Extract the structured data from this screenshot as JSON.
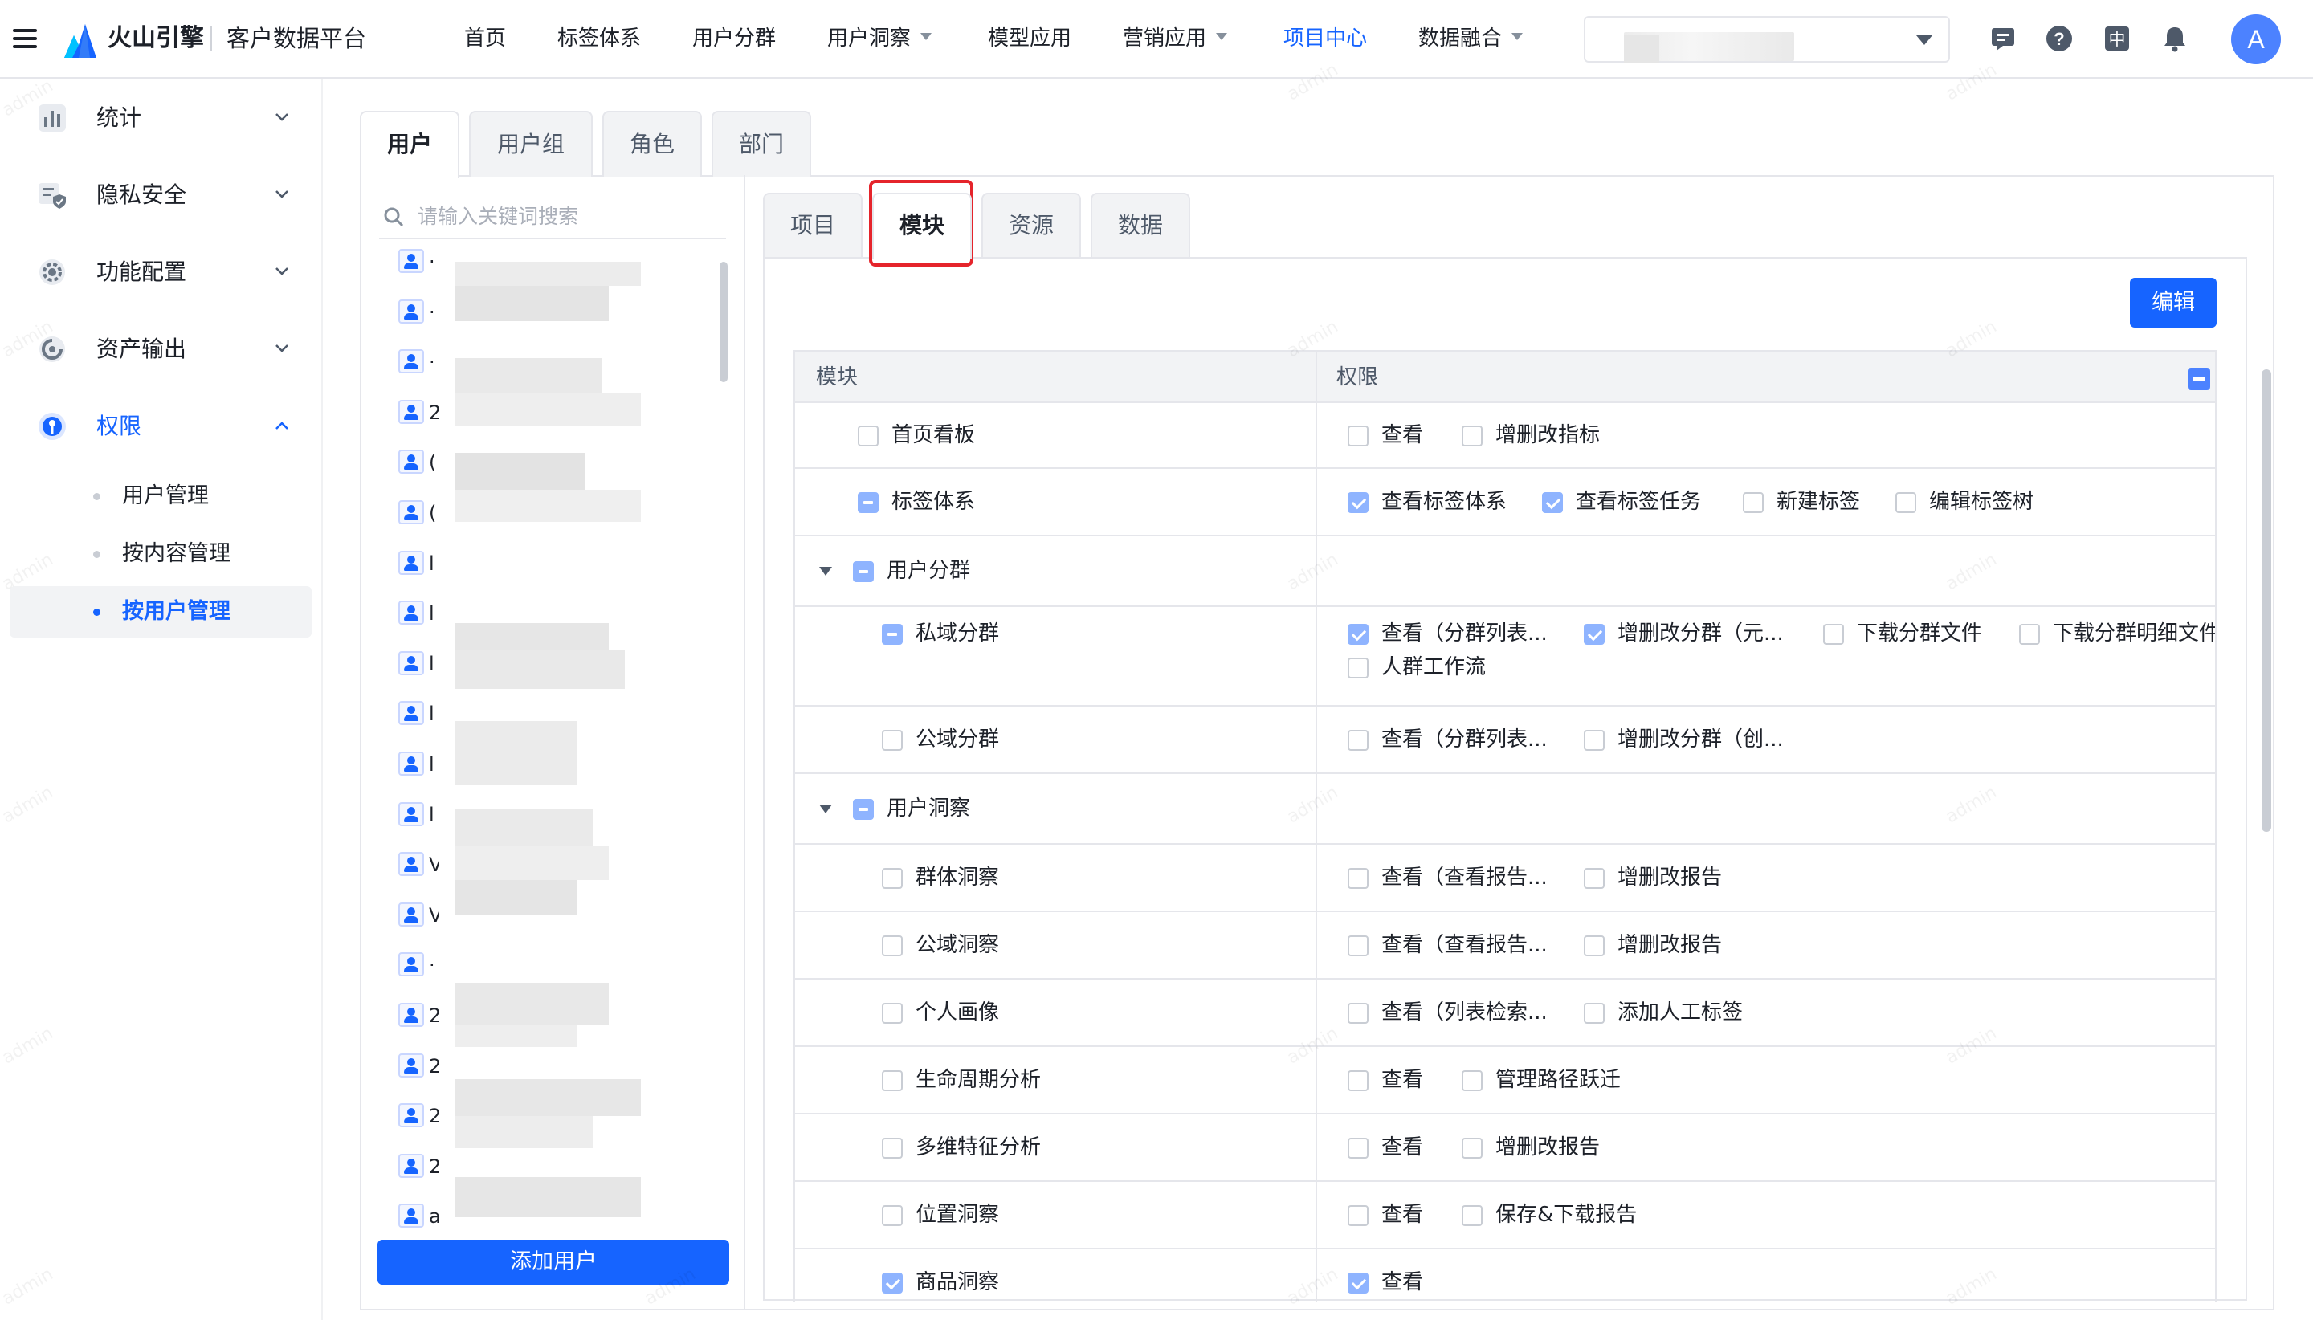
{
  "header": {
    "brand": "火山引擎",
    "product": "客户数据平台",
    "nav": [
      {
        "label": "首页",
        "dropdown": false,
        "active": false
      },
      {
        "label": "标签体系",
        "dropdown": false,
        "active": false
      },
      {
        "label": "用户分群",
        "dropdown": false,
        "active": false
      },
      {
        "label": "用户洞察",
        "dropdown": true,
        "active": false
      },
      {
        "label": "模型应用",
        "dropdown": false,
        "active": false
      },
      {
        "label": "营销应用",
        "dropdown": true,
        "active": false
      },
      {
        "label": "项目中心",
        "dropdown": false,
        "active": true
      },
      {
        "label": "数据融合",
        "dropdown": true,
        "active": false
      }
    ],
    "avatar_letter": "A",
    "icons": [
      "message-icon",
      "help-icon",
      "language-icon",
      "bell-icon"
    ],
    "language_glyph": "中",
    "help_glyph": "?"
  },
  "sidebar": {
    "items": [
      {
        "label": "统计",
        "icon": "chart-icon",
        "expanded": false
      },
      {
        "label": "隐私安全",
        "icon": "shield-icon",
        "expanded": false
      },
      {
        "label": "功能配置",
        "icon": "gear-icon",
        "expanded": false
      },
      {
        "label": "资产输出",
        "icon": "export-icon",
        "expanded": false
      },
      {
        "label": "权限",
        "icon": "key-icon",
        "expanded": true
      }
    ],
    "sub_items": [
      {
        "label": "用户管理",
        "active": false
      },
      {
        "label": "按内容管理",
        "active": false
      },
      {
        "label": "按用户管理",
        "active": true
      }
    ]
  },
  "outer_tabs": [
    "用户",
    "用户组",
    "角色",
    "部门"
  ],
  "user_panel": {
    "search_placeholder": "请输入关键词搜索",
    "users": [
      "·",
      "·",
      "·",
      "2",
      "(",
      "(",
      "l",
      "l",
      "l",
      "l",
      "l",
      "l",
      "V",
      "V",
      "·",
      "2",
      "2",
      "2",
      "2",
      "a"
    ],
    "add_user_label": "添加用户"
  },
  "inner_tabs": [
    "项目",
    "模块",
    "资源",
    "数据"
  ],
  "edit_label": "编辑",
  "table": {
    "col_module": "模块",
    "col_permission": "权限",
    "rows": [
      {
        "type": "module",
        "level": 0,
        "name": "首页看板",
        "state": "unchecked",
        "perms": [
          {
            "label": "查看",
            "checked": false
          },
          {
            "label": "增删改指标",
            "checked": false
          }
        ]
      },
      {
        "type": "module",
        "level": 0,
        "name": "标签体系",
        "state": "indet",
        "perms": [
          {
            "label": "查看标签体系",
            "checked": true
          },
          {
            "label": "查看标签任务",
            "checked": true
          },
          {
            "label": "新建标签",
            "checked": false
          },
          {
            "label": "编辑标签树",
            "checked": false
          }
        ]
      },
      {
        "type": "group",
        "level": 0,
        "name": "用户分群",
        "state": "indet",
        "perms": []
      },
      {
        "type": "module",
        "level": 1,
        "name": "私域分群",
        "state": "indet",
        "perms": [
          {
            "label": "查看（分群列表...",
            "checked": true
          },
          {
            "label": "增删改分群（元...",
            "checked": true
          },
          {
            "label": "下载分群文件",
            "checked": false
          },
          {
            "label": "下载分群明细文件",
            "checked": false
          },
          {
            "label": "人群工作流",
            "checked": false
          }
        ]
      },
      {
        "type": "module",
        "level": 1,
        "name": "公域分群",
        "state": "unchecked",
        "perms": [
          {
            "label": "查看（分群列表...",
            "checked": false
          },
          {
            "label": "增删改分群（创...",
            "checked": false
          }
        ]
      },
      {
        "type": "group",
        "level": 0,
        "name": "用户洞察",
        "state": "indet",
        "perms": []
      },
      {
        "type": "module",
        "level": 1,
        "name": "群体洞察",
        "state": "unchecked",
        "perms": [
          {
            "label": "查看（查看报告...",
            "checked": false
          },
          {
            "label": "增删改报告",
            "checked": false
          }
        ]
      },
      {
        "type": "module",
        "level": 1,
        "name": "公域洞察",
        "state": "unchecked",
        "perms": [
          {
            "label": "查看（查看报告...",
            "checked": false
          },
          {
            "label": "增删改报告",
            "checked": false
          }
        ]
      },
      {
        "type": "module",
        "level": 1,
        "name": "个人画像",
        "state": "unchecked",
        "perms": [
          {
            "label": "查看（列表检索...",
            "checked": false
          },
          {
            "label": "添加人工标签",
            "checked": false
          }
        ]
      },
      {
        "type": "module",
        "level": 1,
        "name": "生命周期分析",
        "state": "unchecked",
        "perms": [
          {
            "label": "查看",
            "checked": false
          },
          {
            "label": "管理路径跃迁",
            "checked": false
          }
        ]
      },
      {
        "type": "module",
        "level": 1,
        "name": "多维特征分析",
        "state": "unchecked",
        "perms": [
          {
            "label": "查看",
            "checked": false
          },
          {
            "label": "增删改报告",
            "checked": false
          }
        ]
      },
      {
        "type": "module",
        "level": 1,
        "name": "位置洞察",
        "state": "unchecked",
        "perms": [
          {
            "label": "查看",
            "checked": false
          },
          {
            "label": "保存&下载报告",
            "checked": false
          }
        ]
      },
      {
        "type": "module",
        "level": 1,
        "name": "商品洞察",
        "state": "checked",
        "perms": [
          {
            "label": "查看",
            "checked": true
          }
        ]
      }
    ]
  },
  "watermark_text": "admin"
}
